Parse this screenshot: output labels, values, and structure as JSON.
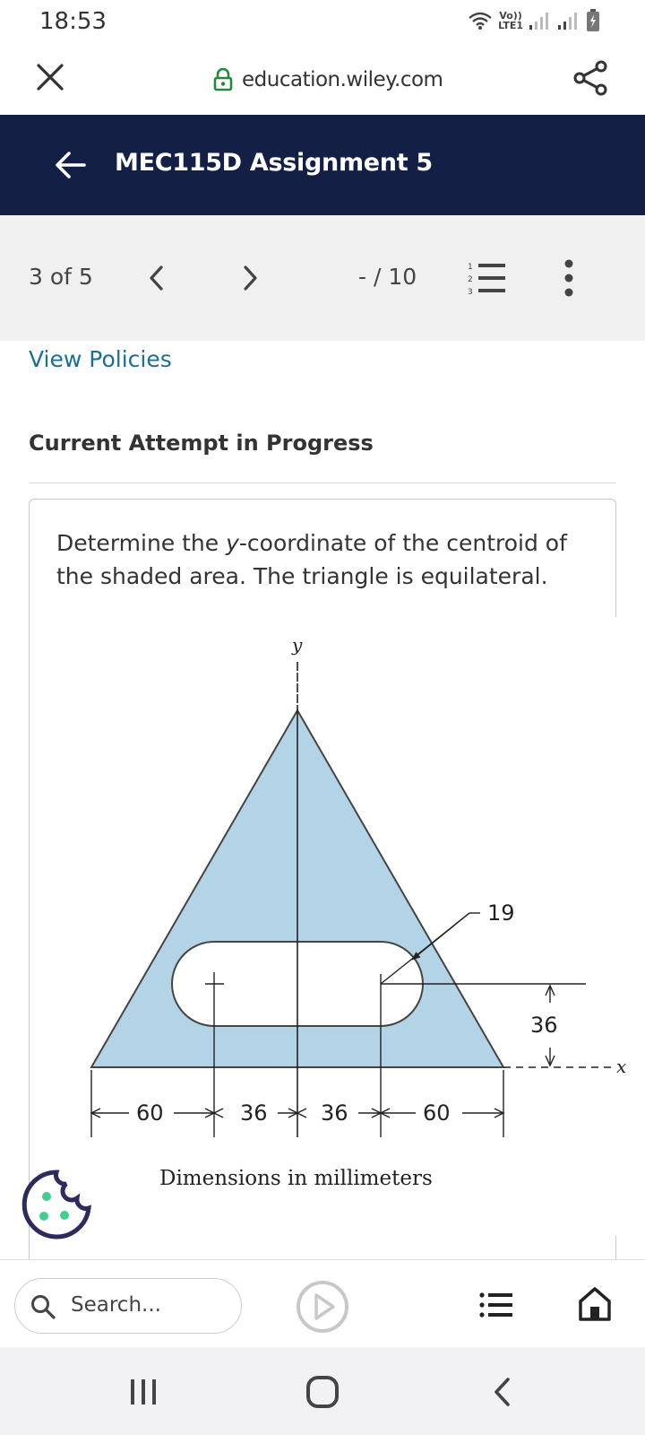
{
  "status_bar": {
    "time": "18:53",
    "network": "Vo)) LTE1",
    "network_line1": "Vo))",
    "network_line2": "LTE1"
  },
  "browser": {
    "url": "education.wiley.com"
  },
  "header": {
    "title": "MEC115D Assignment 5"
  },
  "nav": {
    "position": "3 of 5",
    "score": "- / 10"
  },
  "content": {
    "view_policies": "View Policies",
    "attempt_title": "Current Attempt in Progress",
    "question": "Determine the y-coordinate of the centroid of the shaded area. The triangle is equilateral.",
    "question_before": "Determine the ",
    "question_var": "y",
    "question_after": "-coordinate of the centroid of the shaded area. The triangle is equilateral."
  },
  "figure": {
    "y_axis_label": "y",
    "x_axis_label": "x",
    "radius_label": "19",
    "height_label": "36",
    "dims": [
      "60",
      "36",
      "36",
      "60"
    ],
    "caption": "Dimensions in millimeters",
    "fill_color": "#b3d3e7"
  },
  "toolbar": {
    "search_placeholder": "Search..."
  },
  "colors": {
    "header_bg": "#141f45",
    "link": "#1a6f94",
    "cookie": "#2d2a5e",
    "cookie_dots": "#3fcf8e",
    "lock": "#1f8a3a"
  }
}
